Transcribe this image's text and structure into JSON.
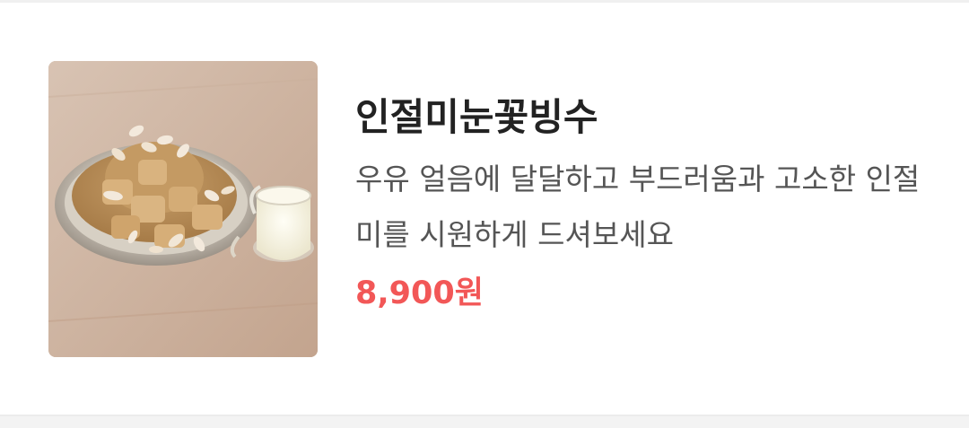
{
  "menu_item": {
    "name": "인절미눈꽃빙수",
    "description": "우유 얼음에 달달하고 부드러움과 고소한 인절미를 시원하게 드셔보세요",
    "price": "8,900원",
    "image_alt": "인절미눈꽃빙수"
  },
  "colors": {
    "price": "#f25757",
    "name": "#222222",
    "description": "#555555"
  }
}
